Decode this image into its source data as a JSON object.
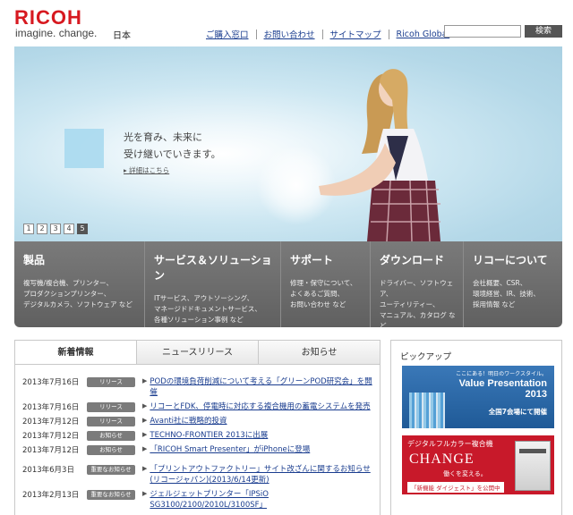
{
  "header": {
    "logo": "RICOH",
    "tagline": "imagine. change.",
    "locale": "日本",
    "links": [
      "ご購入窓口",
      "お問い合わせ",
      "サイトマップ",
      "Ricoh Global"
    ],
    "search_button": "検索",
    "search_value": ""
  },
  "hero": {
    "line1": "光を育み、未来に",
    "line2": "受け継いでいきます。",
    "link": "詳細はこちら",
    "pages": [
      "1",
      "2",
      "3",
      "4",
      "5"
    ],
    "active_page": "5"
  },
  "categories": [
    {
      "title": "製品",
      "desc": [
        "複写機/複合機、プリンター、",
        "プロダクションプリンター、",
        "デジタルカメラ、ソフトウェア など"
      ]
    },
    {
      "title": "サービス＆ソリューション",
      "desc": [
        "ITサービス、アウトソーシング、",
        "マネージドドキュメントサービス、",
        "各種ソリューション事例 など"
      ]
    },
    {
      "title": "サポート",
      "desc": [
        "修理・保守について、",
        "よくあるご質問、",
        "お問い合わせ など"
      ]
    },
    {
      "title": "ダウンロード",
      "desc": [
        "ドライバー、ソフトウェア、",
        "ユーティリティー、",
        "マニュアル、カタログ など"
      ]
    },
    {
      "title": "リコーについて",
      "desc": [
        "会社概要、CSR、",
        "環境経営、IR、技術、",
        "採用情報 など"
      ]
    }
  ],
  "news": {
    "tabs": [
      "新着情報",
      "ニュースリリース",
      "お知らせ"
    ],
    "active_tab": "新着情報",
    "items": [
      {
        "date": "2013年7月16日",
        "badge": "リリース",
        "title": "PODの環境負荷削減について考える「グリーンPOD研究会」を開催"
      },
      {
        "date": "2013年7月16日",
        "badge": "リリース",
        "title": "リコーとFDK、停電時に対応する複合機用の蓄電システムを発売"
      },
      {
        "date": "2013年7月12日",
        "badge": "リリース",
        "title": "Avanti社に戦略的投資"
      },
      {
        "date": "2013年7月12日",
        "badge": "お知らせ",
        "title": "TECHNO-FRONTIER 2013に出展"
      },
      {
        "date": "2013年7月12日",
        "badge": "お知らせ",
        "title": "「RICOH Smart Presenter」がiPhoneに登場"
      },
      {
        "date": "2013年6月3日",
        "badge": "重要なお知らせ",
        "title": "「プリントアウトファクトリー」サイト改ざんに関するお知らせ(リコージャパン)(2013/6/14更新)"
      },
      {
        "date": "2013年2月13日",
        "badge": "重要なお知らせ",
        "title": "ジェルジェットプリンター「IPSiO SG3100/2100/2010L/3100SF」"
      }
    ]
  },
  "pickup": {
    "title": "ピックアップ",
    "ad1": {
      "small": "ここにある！明日のワークスタイル。",
      "big1": "Value Presentation",
      "big2": "2013",
      "sub": "全国7会場にて開催"
    },
    "ad2": {
      "l1": "デジタルフルカラー複合機",
      "l2": "CHANGE",
      "l3": "働くを変える。",
      "l4": "「新機能 ダイジェスト」を公開中"
    }
  }
}
